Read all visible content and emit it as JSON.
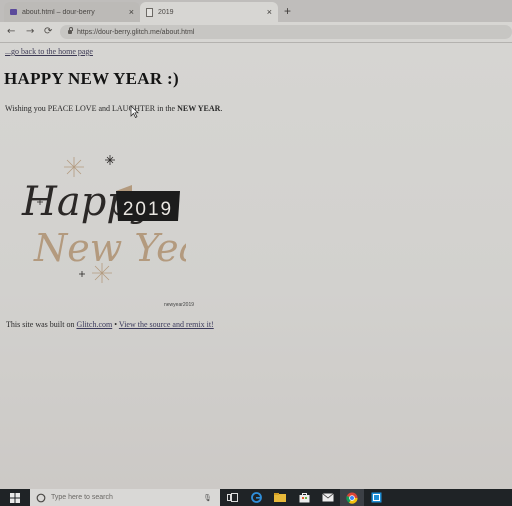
{
  "tabs": [
    {
      "label": "about.html – dour-berry",
      "close": "×"
    },
    {
      "label": "2019",
      "close": "×"
    }
  ],
  "new_tab": "+",
  "nav": {
    "back": "←",
    "forward": "→",
    "reload": "⟳"
  },
  "address": {
    "url": "https://dour-berry.glitch.me/about.html"
  },
  "page": {
    "back_link": "...go back to the home page",
    "heading": "HAPPY NEW YEAR :)",
    "wish_prefix": "Wishing you PEACE LOVE and LAUGHTER in the ",
    "wish_bold": "NEW YEAR",
    "wish_suffix": ".",
    "graphic": {
      "line1": "Happy",
      "badge": "2019",
      "line2": "New Year"
    },
    "caption": "newyear2019",
    "footer": {
      "prefix": "This site was built on ",
      "glitch_link": "Glitch.com",
      "separator": " • ",
      "remix_link": "View the source and remix it!"
    }
  },
  "taskbar": {
    "search_placeholder": "Type here to search",
    "icons": [
      "windows-icon",
      "task-view-icon",
      "edge-icon",
      "file-explorer-icon",
      "store-icon",
      "mail-icon",
      "chrome-icon",
      "photos-icon"
    ]
  },
  "colors": {
    "badge_bg": "#1c1c1c",
    "script_dark": "#2b2827",
    "script_gold": "#b39a7e"
  }
}
